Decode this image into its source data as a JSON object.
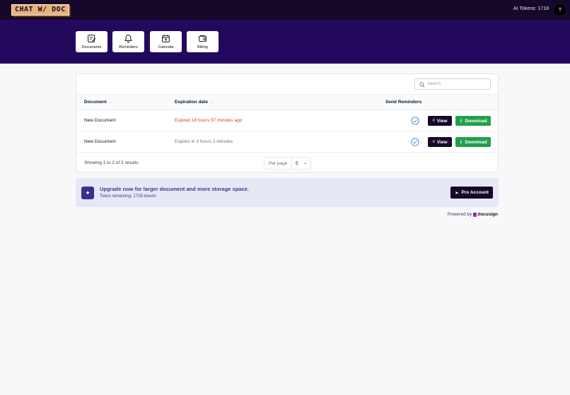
{
  "header": {
    "logo_text": "CHAT W/ DOC",
    "tokens_label": "AI Tokens: 1718",
    "avatar_initial": "T"
  },
  "nav": [
    {
      "label": "Documents",
      "icon": "document-edit-icon"
    },
    {
      "label": "Reminders",
      "icon": "bell-icon"
    },
    {
      "label": "Calendar",
      "icon": "calendar-icon"
    },
    {
      "label": "Billing",
      "icon": "wallet-icon"
    }
  ],
  "search": {
    "placeholder": "Search"
  },
  "table": {
    "columns": [
      "Document",
      "Expiration date",
      "Send Reminders"
    ],
    "rows": [
      {
        "document": "New Document",
        "expiration": "Expired 18 hours 57 minutes ago",
        "expired": true,
        "reminder": true
      },
      {
        "document": "New Document",
        "expiration": "Expires in 3 hours 2 minutes",
        "expired": false,
        "reminder": true
      }
    ],
    "view_label": "View",
    "download_label": "Download",
    "footer": "Showing 1 to 2 of 2 results",
    "per_page_label": "Per page",
    "per_page_value": "5"
  },
  "upgrade": {
    "title": "Upgrade now for larger document and more storage space.",
    "subtitle": "Token remaining: 1718 tokens",
    "button": "Pro Account"
  },
  "powered": {
    "prefix": "Powered by",
    "brand": "docusign"
  },
  "colors": {
    "topbar": "#150829",
    "band": "#23095e",
    "expired_text": "#dc3b30",
    "pending_text": "#6b7280",
    "download_green": "#22a04b",
    "accent_indigo": "#3c3a8e"
  }
}
